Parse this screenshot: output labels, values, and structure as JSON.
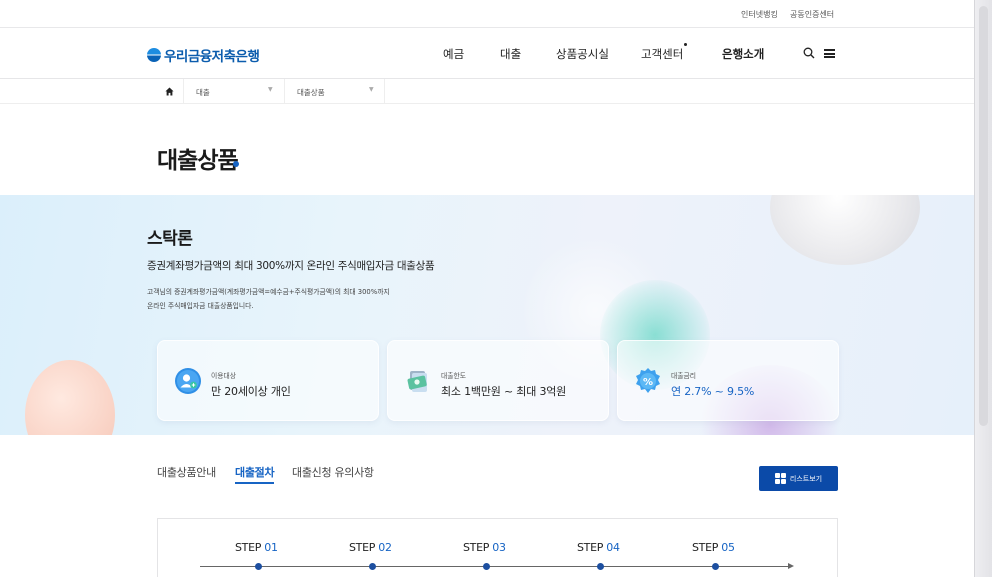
{
  "utility": {
    "links": [
      "인터넷뱅킹",
      "공동인증센터"
    ]
  },
  "header": {
    "logo_text": "우리금융저축은행",
    "nav": [
      {
        "label": "예금"
      },
      {
        "label": "대출"
      },
      {
        "label": "상품공시실"
      },
      {
        "label": "고객센터"
      },
      {
        "label": "은행소개"
      }
    ],
    "icons": [
      "search-icon",
      "menu-icon"
    ]
  },
  "breadcrumb": {
    "home_icon": "home-icon",
    "level1": "대출",
    "level2": "대출상품"
  },
  "page_title": "대출상품",
  "product": {
    "name": "스탁론",
    "subtitle": "증권계좌평가금액의 최대 300%까지 온라인 주식매입자금 대출상품",
    "description_lines": [
      "고객님의 증권계좌평가금액(계좌평가금액=예수금+주식평가금액)의 최대 300%까지",
      "온라인 주식매입자금 대출상품입니다."
    ],
    "cards": [
      {
        "icon": "person-icon",
        "label": "이용대상",
        "value": "만 20세이상 개인"
      },
      {
        "icon": "money-icon",
        "label": "대출한도",
        "value": "최소 1백만원 ~ 최대 3억원"
      },
      {
        "icon": "percent-icon",
        "label": "대출금리",
        "value": "연 2.7% ~ 9.5%"
      }
    ]
  },
  "tabs": [
    {
      "label": "대출상품안내",
      "active": false
    },
    {
      "label": "대출절차",
      "active": true
    },
    {
      "label": "대출신청 유의사항",
      "active": false
    }
  ],
  "list_button": {
    "label": "리스트보기",
    "icon": "grid-icon"
  },
  "steps": [
    {
      "prefix": "STEP ",
      "num": "01"
    },
    {
      "prefix": "STEP ",
      "num": "02"
    },
    {
      "prefix": "STEP ",
      "num": "03"
    },
    {
      "prefix": "STEP ",
      "num": "04"
    },
    {
      "prefix": "STEP ",
      "num": "05"
    }
  ],
  "colors": {
    "brand": "#0b5cad",
    "accent": "#1764c4",
    "button": "#0b4aa8"
  }
}
